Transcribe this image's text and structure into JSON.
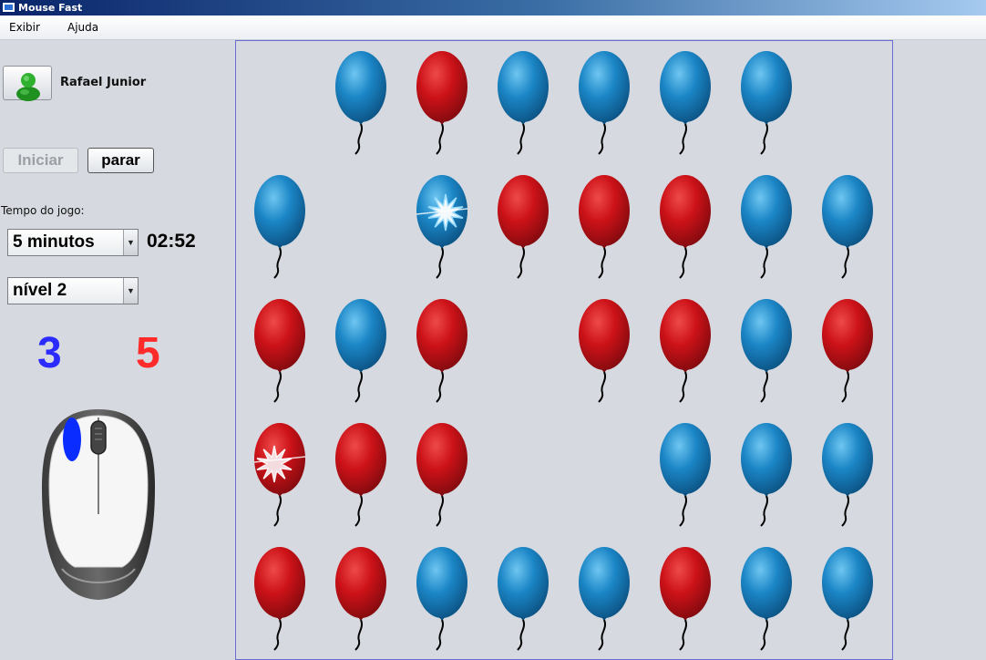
{
  "window": {
    "title": "Mouse Fast"
  },
  "menu": {
    "items": [
      "Exibir",
      "Ajuda"
    ]
  },
  "player": {
    "name": "Rafael Junior"
  },
  "buttons": {
    "start": "Iniciar",
    "stop": "parar"
  },
  "time_label": "Tempo do jogo:",
  "time_select": {
    "value": "5 minutos"
  },
  "level_select": {
    "value": "nível 2"
  },
  "timer": "02:52",
  "scores": {
    "blue": "3",
    "red": "5"
  },
  "colors": {
    "blue": "#1b86c6",
    "red": "#cc1218",
    "score_blue": "#2b2bff",
    "score_red": "#ff2a2a"
  },
  "board": {
    "rows": [
      [
        "empty",
        "blue",
        "red",
        "blue",
        "blue",
        "blue",
        "blue",
        "empty"
      ],
      [
        "blue",
        "empty",
        "blue-popped",
        "red",
        "red",
        "red",
        "blue",
        "blue"
      ],
      [
        "red",
        "blue",
        "red",
        "empty",
        "red",
        "red",
        "blue",
        "red"
      ],
      [
        "red-popped",
        "red",
        "red",
        "empty",
        "empty",
        "blue",
        "blue",
        "blue"
      ],
      [
        "red",
        "red",
        "blue",
        "blue",
        "blue",
        "red",
        "blue",
        "blue"
      ]
    ]
  }
}
